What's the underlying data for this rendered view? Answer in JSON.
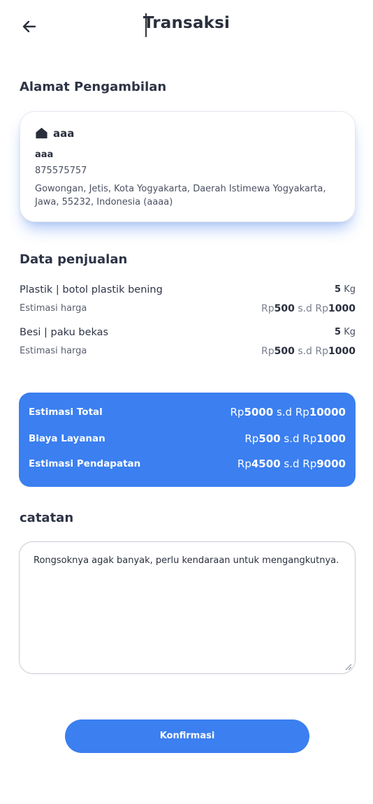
{
  "header": {
    "title": "Transaksi"
  },
  "address": {
    "section_title": "Alamat Pengambilan",
    "label": "aaa",
    "name": "aaa",
    "phone": "875575757",
    "full": "Gowongan, Jetis, Kota Yogyakarta, Daerah Istimewa Yogyakarta, Jawa, 55232, Indonesia (aaaa)"
  },
  "sales": {
    "section_title": "Data penjualan",
    "items": [
      {
        "name": "Plastik | botol plastik bening",
        "weight_value": "5",
        "weight_unit": "Kg",
        "estimate_label": "Estimasi harga",
        "price_prefix": "Rp",
        "price_min": "500",
        "price_sep": "s.d",
        "price_prefix2": "Rp",
        "price_max": "1000"
      },
      {
        "name": "Besi | paku bekas",
        "weight_value": "5",
        "weight_unit": "Kg",
        "estimate_label": "Estimasi harga",
        "price_prefix": "Rp",
        "price_min": "500",
        "price_sep": "s.d",
        "price_prefix2": "Rp",
        "price_max": "1000"
      }
    ]
  },
  "summary": {
    "rows": [
      {
        "label": "Estimasi Total",
        "prefix": "Rp",
        "min": "5000",
        "sep": "s.d",
        "prefix2": "Rp",
        "max": "10000"
      },
      {
        "label": "Biaya Layanan",
        "prefix": "Rp",
        "min": "500",
        "sep": "s.d",
        "prefix2": "Rp",
        "max": "1000"
      },
      {
        "label": "Estimasi Pendapatan",
        "prefix": "Rp",
        "min": "4500",
        "sep": "s.d",
        "prefix2": "Rp",
        "max": "9000"
      }
    ]
  },
  "notes": {
    "section_title": "catatan",
    "value": "Rongsoknya agak banyak, perlu kendaraan untuk mengangkutnya."
  },
  "actions": {
    "confirm_label": "Konfirmasi"
  },
  "icons": {
    "back": "arrow-left-icon",
    "home": "home-icon",
    "resize": "resize-handle-icon"
  },
  "colors": {
    "primary": "#3b7ff0",
    "text": "#2a2f3d"
  }
}
